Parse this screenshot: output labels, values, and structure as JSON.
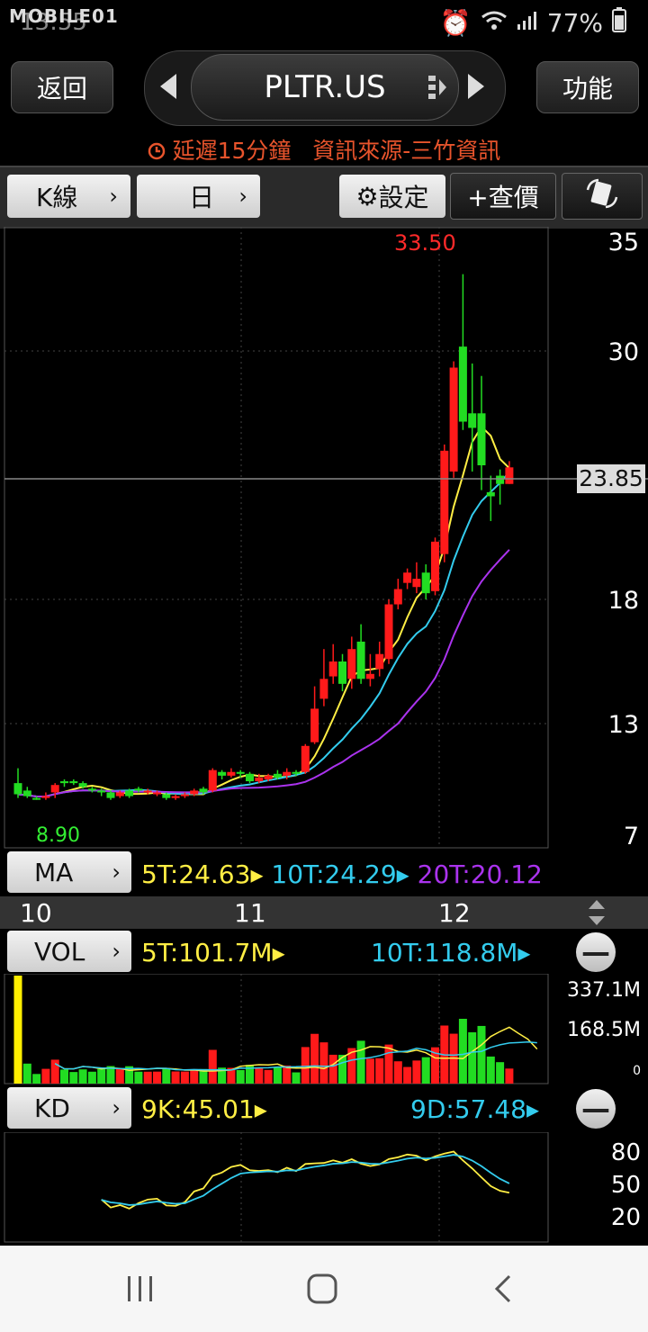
{
  "status_bar": {
    "watermark": "MOBILE01",
    "time": "13:55",
    "battery": "77%"
  },
  "header": {
    "back_label": "返回",
    "symbol": "PLTR.US",
    "menu_label": "功能"
  },
  "notice": {
    "delay": "延遲15分鐘",
    "source": "資訊來源-三竹資訊"
  },
  "toolbar": {
    "kline_label": "K線",
    "period_label": "日",
    "settings_label": "設定",
    "quote_label": "+查價"
  },
  "price_chart": {
    "y_labels": [
      "35",
      "30",
      "23.85",
      "18",
      "13",
      "7"
    ],
    "high_label": "33.50",
    "low_label": "8.90"
  },
  "ma_panel": {
    "button": "MA",
    "ma5": "5T:24.63",
    "ma10": "10T:24.29",
    "ma20": "20T:20.12"
  },
  "x_labels": [
    "10",
    "11",
    "12"
  ],
  "vol_panel": {
    "button": "VOL",
    "v5": "5T:101.7M",
    "v10": "10T:118.8M",
    "y_labels": [
      "337.1M",
      "168.5M",
      "0"
    ]
  },
  "kd_panel": {
    "button": "KD",
    "k": "9K:45.01",
    "d": "9D:57.48",
    "y_labels": [
      "80",
      "50",
      "20"
    ]
  },
  "colors": {
    "up": "#ff1a1a",
    "down": "#22dd22",
    "ma5": "#ffee44",
    "ma10": "#33ccee",
    "ma20": "#aa33ee",
    "notice": "#e8542c"
  },
  "chart_data": {
    "type": "candlestick",
    "candles": [
      {
        "o": 9.8,
        "c": 9.2,
        "h": 10.6,
        "l": 9.0
      },
      {
        "o": 9.4,
        "c": 9.1,
        "h": 9.6,
        "l": 9.0
      },
      {
        "o": 9.0,
        "c": 8.95,
        "h": 9.1,
        "l": 8.9
      },
      {
        "o": 9.0,
        "c": 9.1,
        "h": 9.3,
        "l": 8.9
      },
      {
        "o": 9.3,
        "c": 9.7,
        "h": 9.8,
        "l": 9.0
      },
      {
        "o": 9.9,
        "c": 9.8,
        "h": 10.0,
        "l": 9.6
      },
      {
        "o": 9.9,
        "c": 9.8,
        "h": 10.0,
        "l": 9.7
      },
      {
        "o": 9.8,
        "c": 9.6,
        "h": 9.9,
        "l": 9.5
      },
      {
        "o": 9.5,
        "c": 9.4,
        "h": 9.6,
        "l": 9.3
      },
      {
        "o": 9.4,
        "c": 9.3,
        "h": 9.5,
        "l": 9.1
      },
      {
        "o": 9.3,
        "c": 9.0,
        "h": 9.4,
        "l": 8.9
      },
      {
        "o": 9.1,
        "c": 9.3,
        "h": 9.4,
        "l": 9.0
      },
      {
        "o": 9.4,
        "c": 9.1,
        "h": 9.5,
        "l": 9.0
      },
      {
        "o": 9.5,
        "c": 9.4,
        "h": 9.6,
        "l": 9.3
      },
      {
        "o": 9.3,
        "c": 9.4,
        "h": 9.5,
        "l": 9.2
      },
      {
        "o": 9.2,
        "c": 9.3,
        "h": 9.4,
        "l": 9.1
      },
      {
        "o": 9.2,
        "c": 9.0,
        "h": 9.3,
        "l": 8.9
      },
      {
        "o": 9.0,
        "c": 9.1,
        "h": 9.2,
        "l": 8.9
      },
      {
        "o": 9.1,
        "c": 9.2,
        "h": 9.3,
        "l": 9.0
      },
      {
        "o": 9.2,
        "c": 9.4,
        "h": 9.5,
        "l": 9.1
      },
      {
        "o": 9.5,
        "c": 9.3,
        "h": 9.6,
        "l": 9.2
      },
      {
        "o": 9.4,
        "c": 10.5,
        "h": 10.6,
        "l": 9.3
      },
      {
        "o": 10.4,
        "c": 10.2,
        "h": 10.5,
        "l": 10.0
      },
      {
        "o": 10.2,
        "c": 10.4,
        "h": 10.6,
        "l": 10.1
      },
      {
        "o": 10.4,
        "c": 10.3,
        "h": 10.5,
        "l": 10.1
      },
      {
        "o": 10.3,
        "c": 9.9,
        "h": 10.4,
        "l": 9.8
      },
      {
        "o": 9.9,
        "c": 10.1,
        "h": 10.3,
        "l": 9.8
      },
      {
        "o": 10.0,
        "c": 10.2,
        "h": 10.3,
        "l": 9.9
      },
      {
        "o": 10.3,
        "c": 10.1,
        "h": 10.5,
        "l": 10.0
      },
      {
        "o": 10.2,
        "c": 10.4,
        "h": 10.6,
        "l": 10.0
      },
      {
        "o": 10.4,
        "c": 10.3,
        "h": 10.5,
        "l": 10.2
      },
      {
        "o": 10.4,
        "c": 11.8,
        "h": 11.9,
        "l": 10.3
      },
      {
        "o": 12.0,
        "c": 13.6,
        "h": 14.5,
        "l": 11.9
      },
      {
        "o": 14.0,
        "c": 14.8,
        "h": 16.0,
        "l": 13.7
      },
      {
        "o": 14.9,
        "c": 15.5,
        "h": 16.2,
        "l": 14.6
      },
      {
        "o": 15.5,
        "c": 14.6,
        "h": 15.8,
        "l": 14.3
      },
      {
        "o": 14.8,
        "c": 16.0,
        "h": 16.5,
        "l": 14.4
      },
      {
        "o": 16.3,
        "c": 14.8,
        "h": 17.0,
        "l": 14.6
      },
      {
        "o": 14.8,
        "c": 15.0,
        "h": 15.8,
        "l": 14.5
      },
      {
        "o": 15.2,
        "c": 15.8,
        "h": 16.3,
        "l": 14.9
      },
      {
        "o": 15.6,
        "c": 17.8,
        "h": 18.0,
        "l": 15.4
      },
      {
        "o": 17.8,
        "c": 18.5,
        "h": 19.0,
        "l": 17.6
      },
      {
        "o": 18.8,
        "c": 19.3,
        "h": 19.5,
        "l": 18.5
      },
      {
        "o": 18.6,
        "c": 19.0,
        "h": 19.8,
        "l": 18.3
      },
      {
        "o": 19.3,
        "c": 18.3,
        "h": 19.7,
        "l": 18.0
      },
      {
        "o": 18.4,
        "c": 20.8,
        "h": 21.0,
        "l": 18.2
      },
      {
        "o": 20.2,
        "c": 25.2,
        "h": 25.5,
        "l": 19.8
      },
      {
        "o": 24.2,
        "c": 29.2,
        "h": 29.5,
        "l": 23.9
      },
      {
        "o": 30.2,
        "c": 26.6,
        "h": 33.5,
        "l": 26.2
      },
      {
        "o": 27.0,
        "c": 26.3,
        "h": 29.4,
        "l": 24.2
      },
      {
        "o": 27.0,
        "c": 24.5,
        "h": 28.8,
        "l": 23.3
      },
      {
        "o": 23.2,
        "c": 23.0,
        "h": 24.0,
        "l": 21.8
      },
      {
        "o": 24.0,
        "c": 23.6,
        "h": 24.3,
        "l": 22.6
      },
      {
        "o": 23.6,
        "c": 24.4,
        "h": 24.7,
        "l": 23.6
      }
    ],
    "annotations": [
      "33.50",
      "8.90"
    ],
    "ylim": [
      7,
      35
    ]
  }
}
